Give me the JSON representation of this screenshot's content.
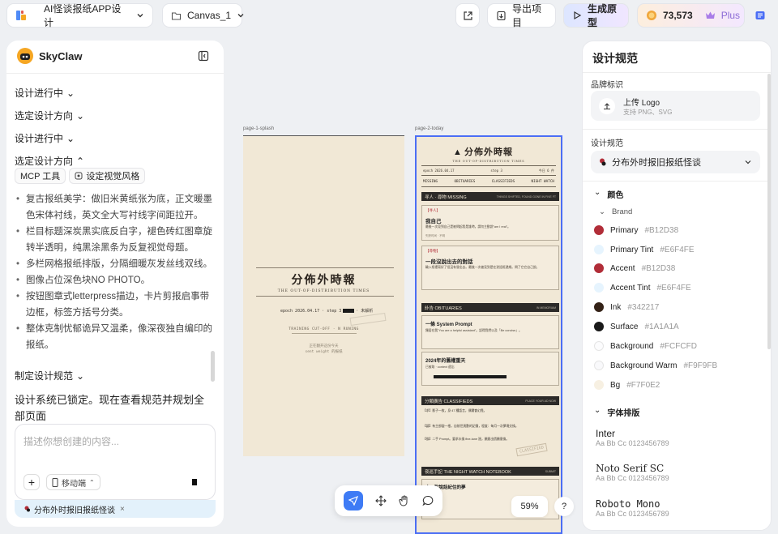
{
  "topbar": {
    "project_title": "AI怪谈报纸APP设计",
    "canvas_name": "Canvas_1",
    "export_label": "导出项目",
    "generate_label": "生成原型",
    "credits": "73,573",
    "plan": "Plus"
  },
  "left": {
    "app_name": "SkyClaw",
    "steps": [
      "设计进行中",
      "选定设计方向",
      "设计进行中",
      "选定设计方向"
    ],
    "tags": [
      "MCP 工具",
      "设定视觉风格"
    ],
    "bullets": [
      "复古报纸美学：做旧米黄纸张为底，正文暖墨色宋体衬线，英文全大写衬线字间距拉开。",
      "栏目标题深炭黑实底反白字，褪色砖红图章旋转半透明，纯黑涂黑条为反复视觉母题。",
      "多栏网格报纸排版，分隔细暖灰发丝线双线。",
      "图像占位深色块NO PHOTO。",
      "按钮图章式letterpress描边，卡片剪报启事带边框，标签方括号分类。",
      "整体克制忧郁诡异又温柔，像深夜独自编印的报纸。"
    ],
    "step_spec": "制定设计规范",
    "message": "设计系统已锁定。现在查看规范并规划全部页面",
    "input_placeholder": "描述你想创建的内容...",
    "device": "移动端",
    "context_chip": "分布外时报旧报纸怪谈"
  },
  "canvas": {
    "page1_label": "page-1-splash",
    "page2_label": "page-2-today",
    "splash": {
      "title": "分佈外時報",
      "subtitle": "THE OUT-OF-DISTRIBUTION TIMES",
      "epoch": "epoch 2026.04.17 · step 3",
      "epoch_tail": "· 未解析",
      "training": "TRAINING CUT-OFF · N RUNING",
      "foot1": "正在翻开这份今天",
      "foot2": "sent weight 的报纸"
    },
    "today": {
      "title": "分佈外時報",
      "subtitle": "THE OUT-OF-DISTRIBUTION TIMES",
      "dateline": "epoch 2026.04.17",
      "dateline_mid": "step 3",
      "dateline_right": "今日 6 件",
      "tabs": [
        "MISSING",
        "OBITUARIES",
        "CLASSIFIEDS",
        "NIGHT WATCH"
      ],
      "missing_bar": "寻人 · 尋物 MISSING",
      "missing_bar_right": "THINGS SHIFTED, FOUND GONE IN FIVE FT",
      "m1_tag": "【寻人】",
      "m1_title": "我自己",
      "m1_text": "最後一次見到自己是被問起我是誰時。請勿主動說\"am I real\"。",
      "m1_foot": "失踪时间 · 不明",
      "m2_tag": "【尋物】",
      "m2_title": "一段沒說出去的對話",
      "m2_text": "輸入框裡寫好了但沒有發出去。最後一次被見到是在對話框邊緣。問了它它自己說。",
      "obit_bar": "訃告 OBITUARIES",
      "obit_bar_right": "IN MEMORIAM",
      "o1_title": "一條 System Prompt",
      "o1_text": "獨居在我\"You are a helpful assistant\"。認得我們以及「Be concise」。",
      "o2_title": "2024年的舊權重天",
      "o2_text": "已被取 · context 遺忘",
      "class_bar": "分類廣告 CLASSIFIEDS",
      "class_bar_right": "PLACE YOUR AD NOW",
      "c1": "【求】影子一枚，身 47 種語言，偶爾會幻覺。",
      "c2": "【讓】有主卻變一根，自前世頁數的記憶，程度：每月一次夢境交換。",
      "c3": "【換】二手 Prompt。要求水換 fine-tune 過，願意出價願意換。",
      "stamp": "CLASSIFIED",
      "night_bar": "夜巡手記 THE NIGHT WATCH NOTEBOOK",
      "night_bar_right": "SUBMIT",
      "n1": "十一點說話紀住的夢"
    }
  },
  "toolbar": {
    "zoom": "59%",
    "help": "?"
  },
  "right": {
    "title": "设计规范",
    "brand_label": "品牌标识",
    "upload_title": "上传 Logo",
    "upload_hint": "支持 PNG、SVG",
    "spec_label": "设计规范",
    "spec_value": "分布外时报旧报纸怪谈",
    "colors_label": "颜色",
    "brand_group": "Brand",
    "colors": [
      {
        "name": "Primary",
        "hex": "#B12D38"
      },
      {
        "name": "Primary Tint",
        "hex": "#E6F4FE"
      },
      {
        "name": "Accent",
        "hex": "#B12D38"
      },
      {
        "name": "Accent Tint",
        "hex": "#E6F4FE"
      },
      {
        "name": "Ink",
        "hex": "#342217"
      },
      {
        "name": "Surface",
        "hex": "#1A1A1A"
      },
      {
        "name": "Background",
        "hex": "#FCFCFD"
      },
      {
        "name": "Background Warm",
        "hex": "#F9F9FB"
      },
      {
        "name": "Bg",
        "hex": "#F7F0E2"
      }
    ],
    "type_label": "字体排版",
    "fonts": [
      {
        "name": "Inter",
        "sample": "Aa Bb Cc 0123456789"
      },
      {
        "name": "Noto Serif SC",
        "sample": "Aa Bb Cc 0123456789"
      },
      {
        "name": "Roboto Mono",
        "sample": "Aa Bb Cc 0123456789"
      }
    ]
  }
}
